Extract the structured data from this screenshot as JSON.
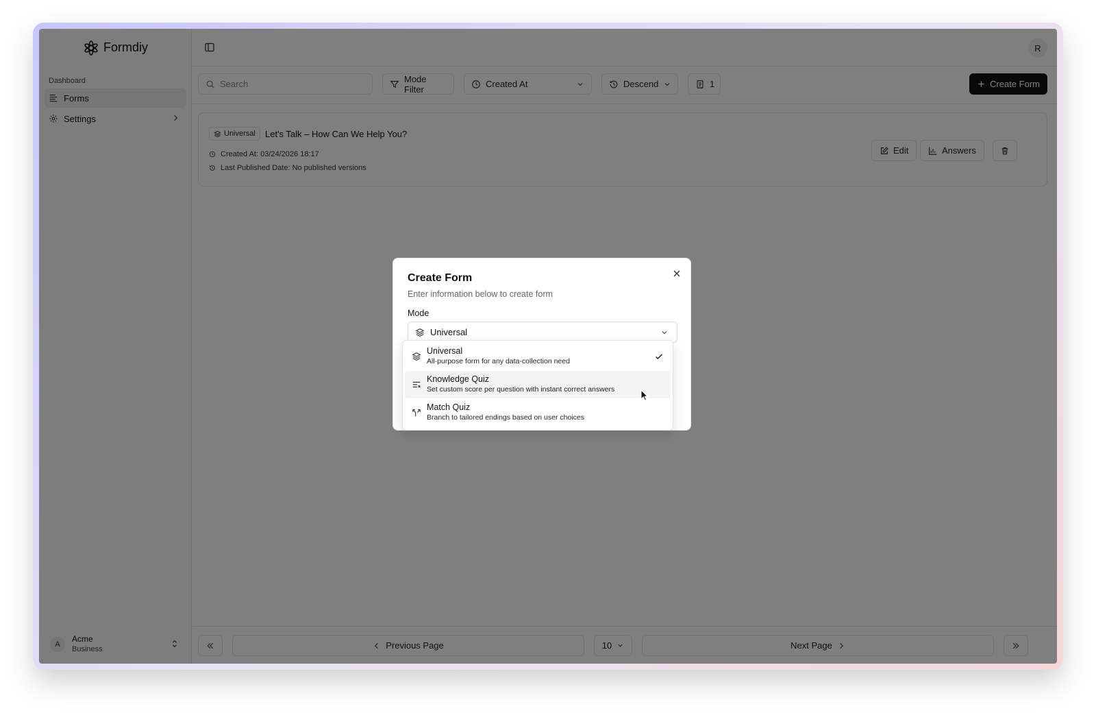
{
  "app": {
    "name": "Formdiy"
  },
  "sidebar": {
    "section": "Dashboard",
    "items": [
      {
        "label": "Forms",
        "icon": "forms-icon",
        "active": true
      },
      {
        "label": "Settings",
        "icon": "gear-icon",
        "active": false
      }
    ],
    "org": {
      "initial": "A",
      "name": "Acme",
      "plan": "Business"
    }
  },
  "header": {
    "user_initial": "R"
  },
  "toolbar": {
    "search_placeholder": "Search",
    "mode_filter": "Mode Filter",
    "sort_field": "Created At",
    "sort_order": "Descend",
    "count": "1",
    "create_label": "Create Form"
  },
  "forms": [
    {
      "mode": "Universal",
      "title": "Let's Talk – How Can We Help You?",
      "created": "Created At: 03/24/2026 18:17",
      "published": "Last Published Date: No published versions",
      "actions": {
        "edit": "Edit",
        "answers": "Answers"
      }
    }
  ],
  "pagination": {
    "previous": "Previous Page",
    "page_size": "10",
    "next": "Next Page"
  },
  "dialog": {
    "title": "Create Form",
    "subtitle": "Enter information below to create form",
    "mode_label": "Mode",
    "selected_mode": "Universal",
    "options": [
      {
        "label": "Universal",
        "description": "All-purpose form for any data-collection need",
        "icon": "layers-icon",
        "selected": true
      },
      {
        "label": "Knowledge Quiz",
        "description": "Set custom score per question with instant correct answers",
        "icon": "list-x-icon",
        "selected": false
      },
      {
        "label": "Match Quiz",
        "description": "Branch to tailored endings based on user choices",
        "icon": "split-icon",
        "selected": false
      }
    ]
  },
  "colors": {
    "primary_button": "#121212",
    "overlay": "rgba(0,0,0,0.5)",
    "hover_row": "#f3f3f3"
  }
}
